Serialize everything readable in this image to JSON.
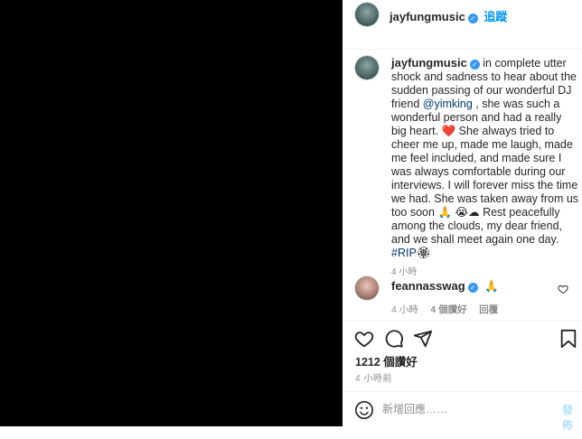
{
  "post": {
    "author": "jayfungmusic",
    "follow_label": "追蹤",
    "caption_parts": {
      "p1": "in complete utter shock and sadness to hear about the sudden passing of our wonderful DJ friend ",
      "mention": "@yimking",
      "p2": " , she was such a wonderful person and had a really big heart. ",
      "heart": "❤️",
      "p3": " She always tried to cheer me up, made me laugh, made me feel included, and made sure I was always comfortable during our interviews. I will forever miss the time we had. She was taken away from us too soon ",
      "pray": "🙏",
      "crying": "😭",
      "cloud": "☁",
      "p4": " Rest peacefully among the clouds, my dear friend, and we shall meet again one day. ",
      "hashtag": "#RIP",
      "flower": "🏵"
    },
    "caption_time": "4 小時"
  },
  "comments": [
    {
      "author": "feannasswag",
      "text": "🙏",
      "time": "4 小時",
      "likes": "4 個讚好",
      "reply": "回覆"
    }
  ],
  "actions": {
    "likes_count": "1212 個讚好",
    "posted_ago": "4 小時前"
  },
  "comment_box": {
    "placeholder": "新增回應……",
    "post_label": "發佈"
  },
  "colors": {
    "link": "#0095f6",
    "mention": "#00376b",
    "verified": "#3897f0",
    "heart": "#ed4956"
  }
}
